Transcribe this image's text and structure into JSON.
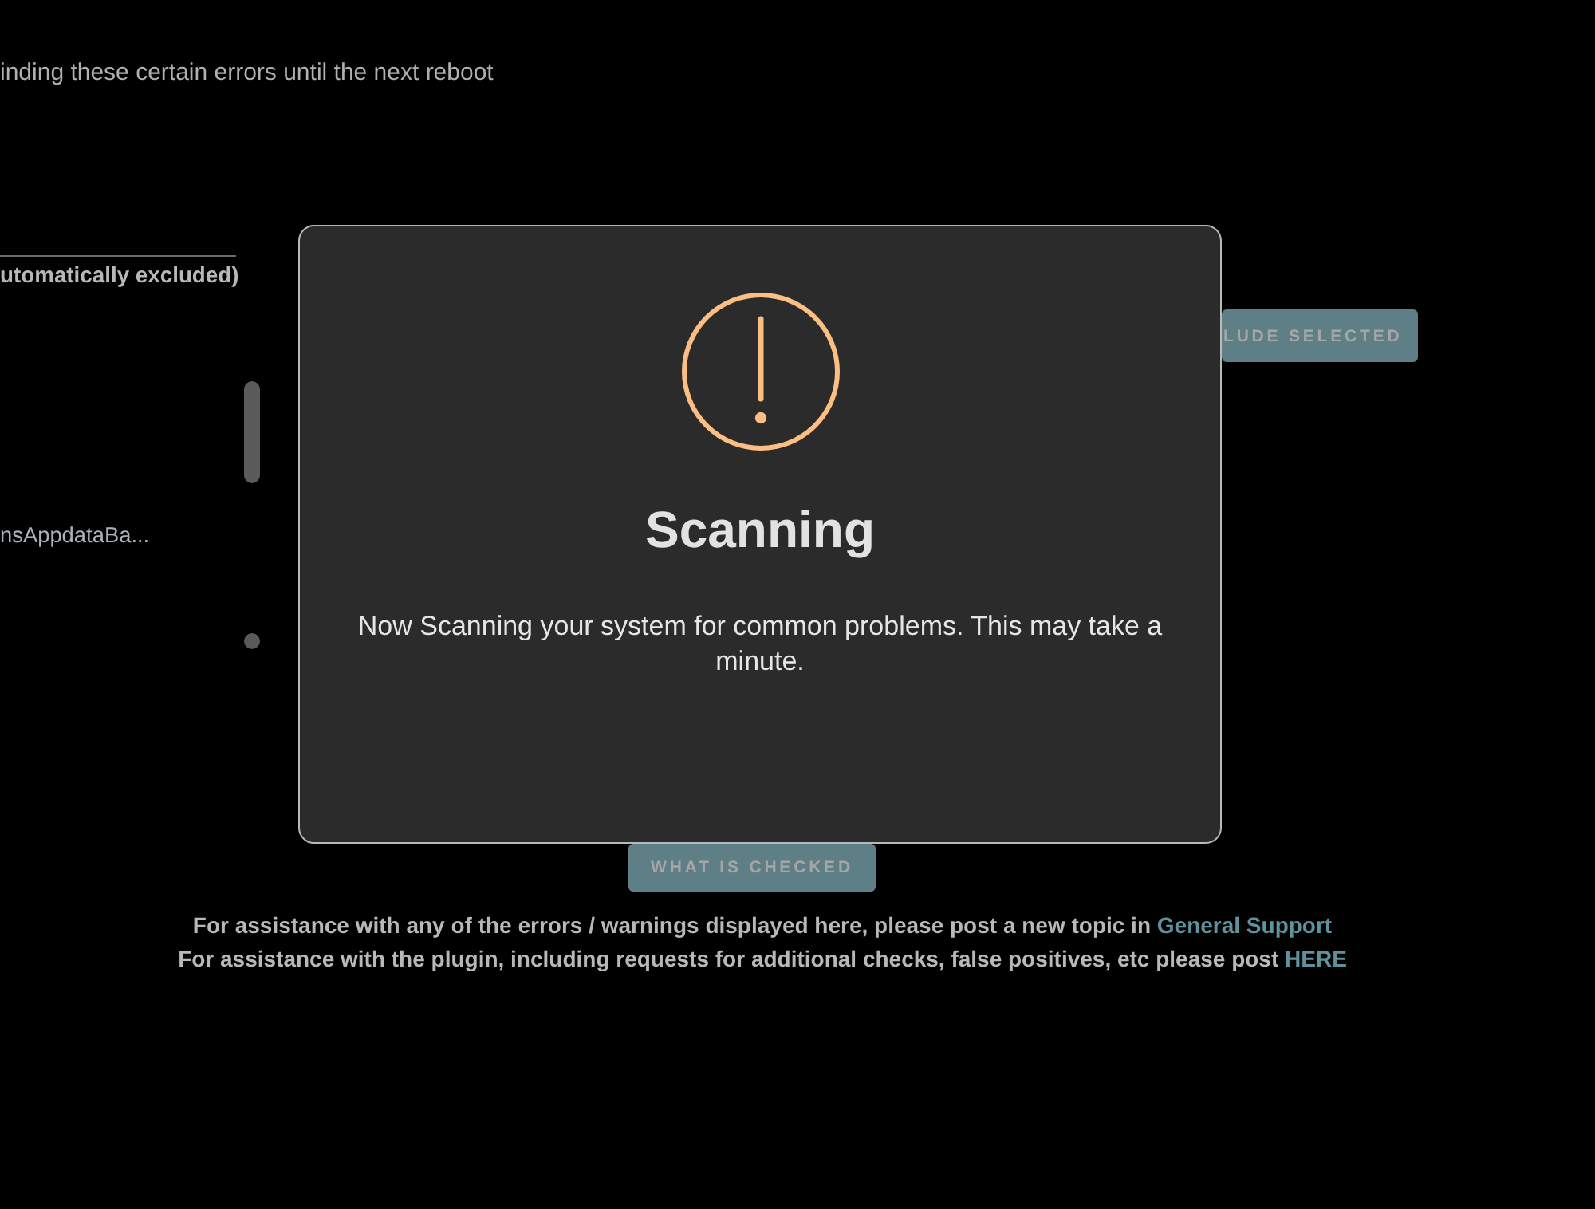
{
  "background": {
    "notice": "inding these certain errors until the next reboot",
    "excluded_list": {
      "heading": "utomatically excluded)",
      "items": [
        "nsAppdataBa..."
      ]
    },
    "exclude_button": "LUDE SELECTED",
    "what_is_checked_button": "WHAT IS CHECKED",
    "help_lines": [
      {
        "text": "For assistance with any of the errors / warnings displayed here, please post a new topic in",
        "link": "General Support"
      },
      {
        "text": "For assistance with the plugin, including requests for additional checks, false positives, etc please post",
        "link": "HERE"
      }
    ]
  },
  "modal": {
    "title": "Scanning",
    "message": "Now Scanning your system for common problems. This may take a minute."
  }
}
